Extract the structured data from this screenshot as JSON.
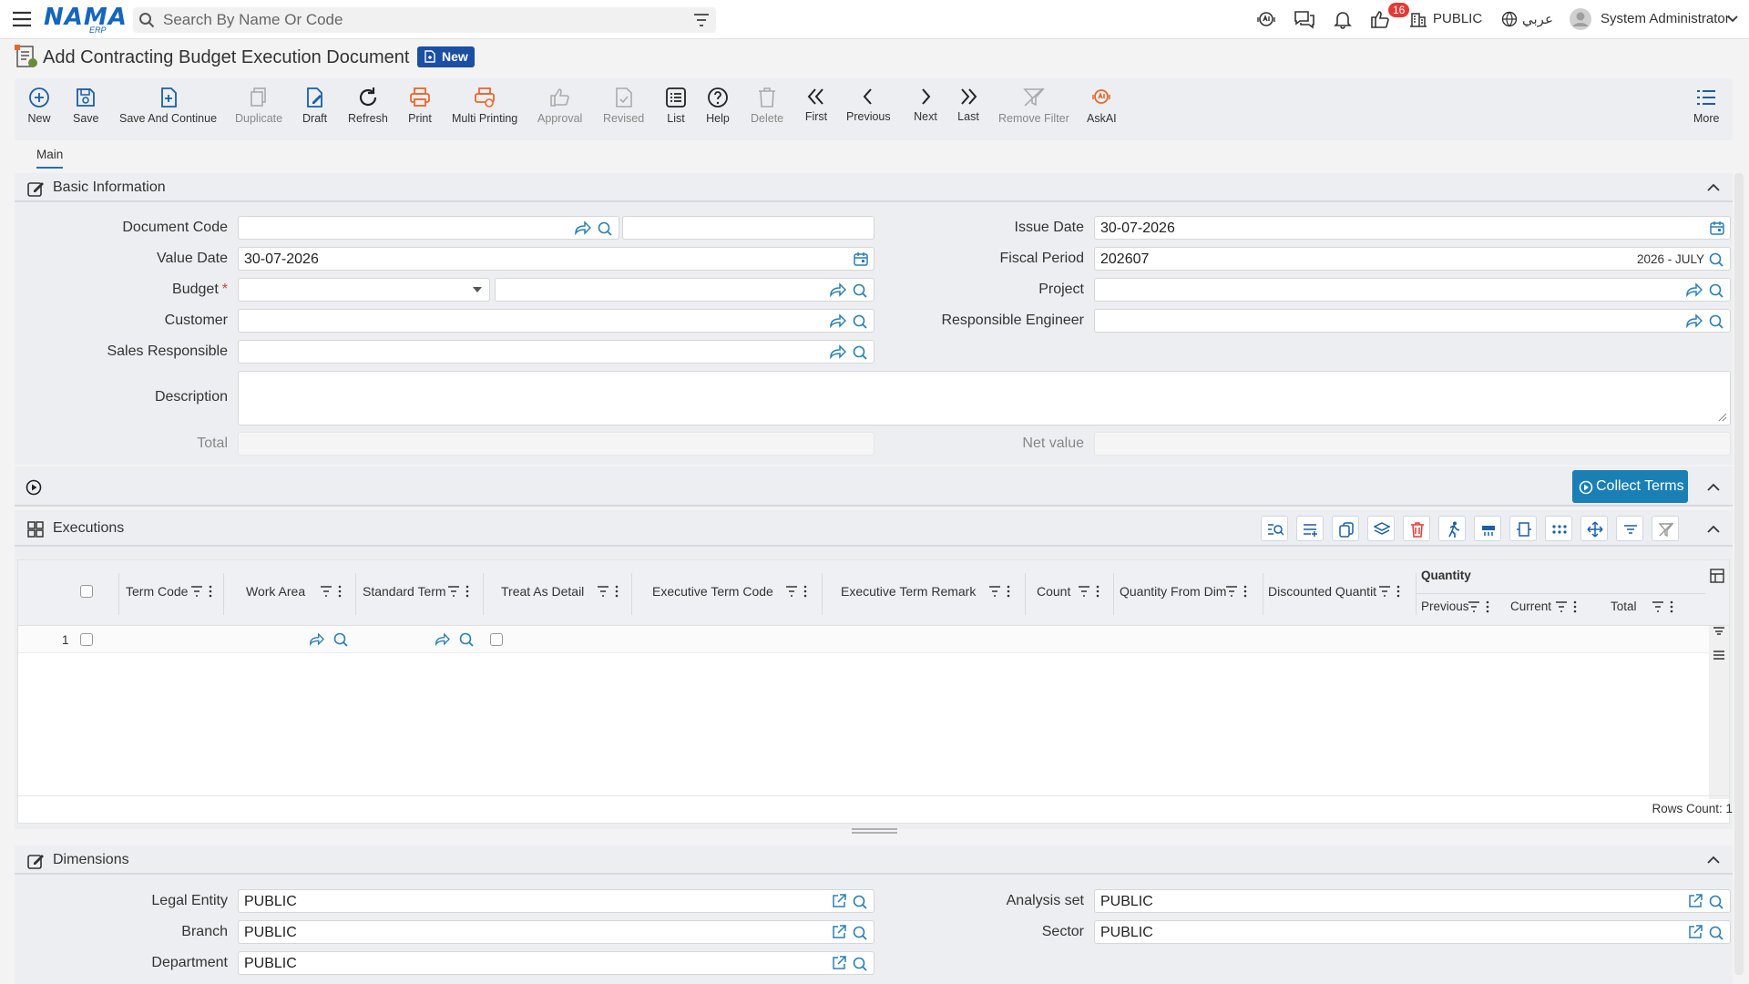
{
  "topbar": {
    "logo_main": "NAMA",
    "logo_sub": "ERP",
    "search_placeholder": "Search By Name Or Code",
    "notification_count": "16",
    "company": "PUBLIC",
    "language": "عربي",
    "user_name": "System Administrator"
  },
  "page": {
    "title": "Add Contracting Budget Execution Document",
    "status": "New"
  },
  "toolbar": {
    "new": "New",
    "save": "Save",
    "save_continue": "Save And Continue",
    "duplicate": "Duplicate",
    "draft": "Draft",
    "refresh": "Refresh",
    "print": "Print",
    "multi_printing": "Multi Printing",
    "approval": "Approval",
    "revised": "Revised",
    "list": "List",
    "help": "Help",
    "delete": "Delete",
    "first": "First",
    "previous": "Previous",
    "next": "Next",
    "last": "Last",
    "remove_filter": "Remove Filter",
    "askai": "AskAI",
    "more": "More"
  },
  "tabs": {
    "main": "Main"
  },
  "basic": {
    "title": "Basic Information",
    "document_code": "Document Code",
    "issue_date": "Issue Date",
    "issue_date_value": "30-07-2026",
    "value_date": "Value Date",
    "value_date_value": "30-07-2026",
    "fiscal_period": "Fiscal Period",
    "fiscal_period_value": "202607",
    "fiscal_period_name": "2026 - JULY",
    "budget": "Budget",
    "project": "Project",
    "customer": "Customer",
    "responsible_engineer": "Responsible Engineer",
    "sales_responsible": "Sales Responsible",
    "description": "Description",
    "total": "Total",
    "net_value": "Net value"
  },
  "collect_terms": "Collect Terms",
  "executions": {
    "title": "Executions",
    "columns": {
      "term_code": "Term Code",
      "work_area": "Work Area",
      "standard_term": "Standard Term",
      "treat_as_detail": "Treat As Detail",
      "executive_term_code": "Executive Term Code",
      "executive_term_remark": "Executive Term Remark",
      "count": "Count",
      "quantity_from_dim": "Quantity From Dim",
      "discounted_quantity": "Discounted Quantit",
      "quantity_group": "Quantity",
      "previous": "Previous",
      "current": "Current",
      "total": "Total"
    },
    "row_number": "1",
    "rows_count": "Rows Count: 1"
  },
  "dimensions": {
    "title": "Dimensions",
    "legal_entity": "Legal Entity",
    "legal_entity_value": "PUBLIC",
    "analysis_set": "Analysis set",
    "analysis_set_value": "PUBLIC",
    "branch": "Branch",
    "branch_value": "PUBLIC",
    "sector": "Sector",
    "sector_value": "PUBLIC",
    "department": "Department",
    "department_value": "PUBLIC"
  },
  "colors": {
    "accent": "#1565c0",
    "toolbar_blue": "#1a5fa6",
    "print_orange": "#e8672a",
    "collect_button": "#1a7fb5",
    "badge_red": "#e53935"
  }
}
